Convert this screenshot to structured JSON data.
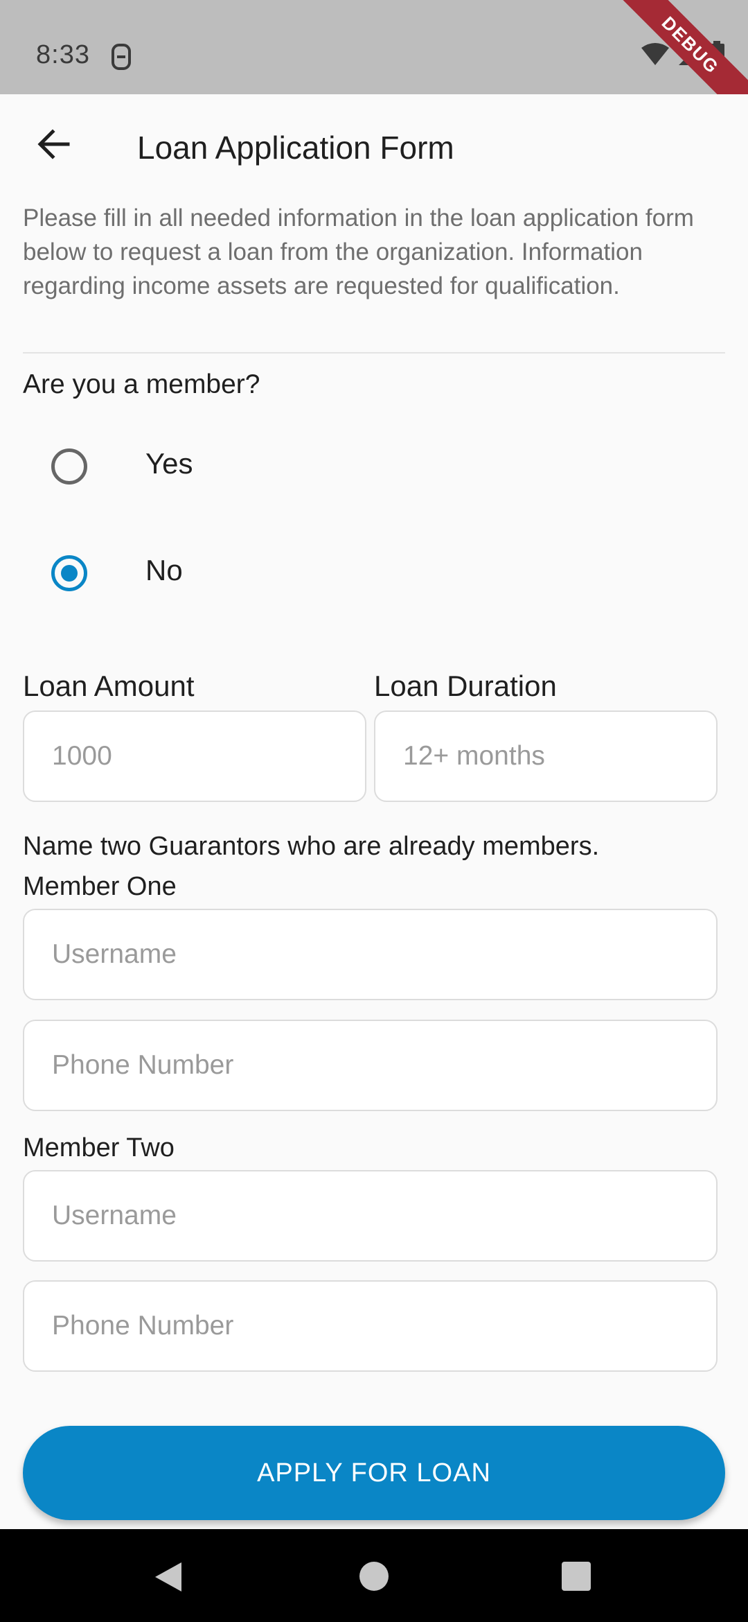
{
  "status_bar": {
    "time": "8:33",
    "debug_label": "DEBUG"
  },
  "header": {
    "title": "Loan Application Form"
  },
  "intro": {
    "text": "Please fill in all needed information in the loan application form below to request a loan from the organization. Information regarding income assets are requested for qualification."
  },
  "membership": {
    "question": "Are you a member?",
    "options": [
      {
        "label": "Yes",
        "selected": false
      },
      {
        "label": "No",
        "selected": true
      }
    ]
  },
  "loan": {
    "amount_label": "Loan Amount",
    "amount_placeholder": "1000",
    "duration_label": "Loan Duration",
    "duration_placeholder": "12+ months"
  },
  "guarantors": {
    "instruction": "Name two Guarantors who are already members.",
    "member_one_label": "Member One",
    "member_two_label": "Member Two",
    "username_placeholder": "Username",
    "phone_placeholder": "Phone Number"
  },
  "actions": {
    "apply_label": "APPLY FOR LOAN"
  },
  "colors": {
    "accent": "#0a86c6",
    "status_bar": "#bdbdbd",
    "debug_ribbon": "#a52a35"
  },
  "icons": [
    "back-arrow-icon",
    "sim-card-icon",
    "wifi-icon",
    "signal-icon",
    "battery-icon",
    "nav-back-icon",
    "nav-home-icon",
    "nav-recents-icon"
  ]
}
